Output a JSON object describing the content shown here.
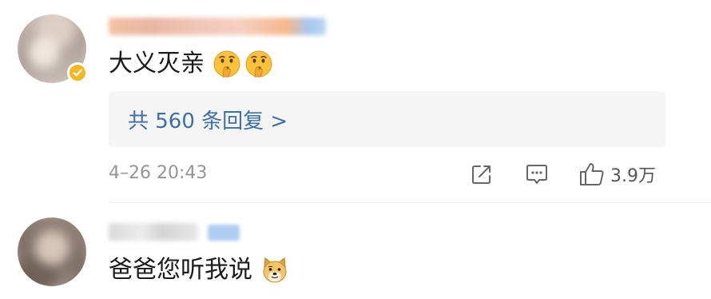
{
  "comments": [
    {
      "text": "大义灭亲",
      "emojis": [
        "thinking-hush-emoji",
        "thinking-hush-emoji"
      ],
      "verified_badge": true,
      "replies_label": "共 560 条回复 >",
      "time": "4–26 20:43",
      "actions": {
        "share_icon": "share-icon",
        "comment_icon": "comment-icon",
        "like_icon": "thumbs-up-icon",
        "like_count": "3.9万"
      }
    },
    {
      "text": "爸爸您听我说",
      "emojis": [
        "doge-emoji"
      ]
    }
  ],
  "colors": {
    "link": "#3f6fa8",
    "meta_text": "#949494",
    "reply_box_bg": "#f5f5f5",
    "verified_badge": "#f5b823"
  }
}
